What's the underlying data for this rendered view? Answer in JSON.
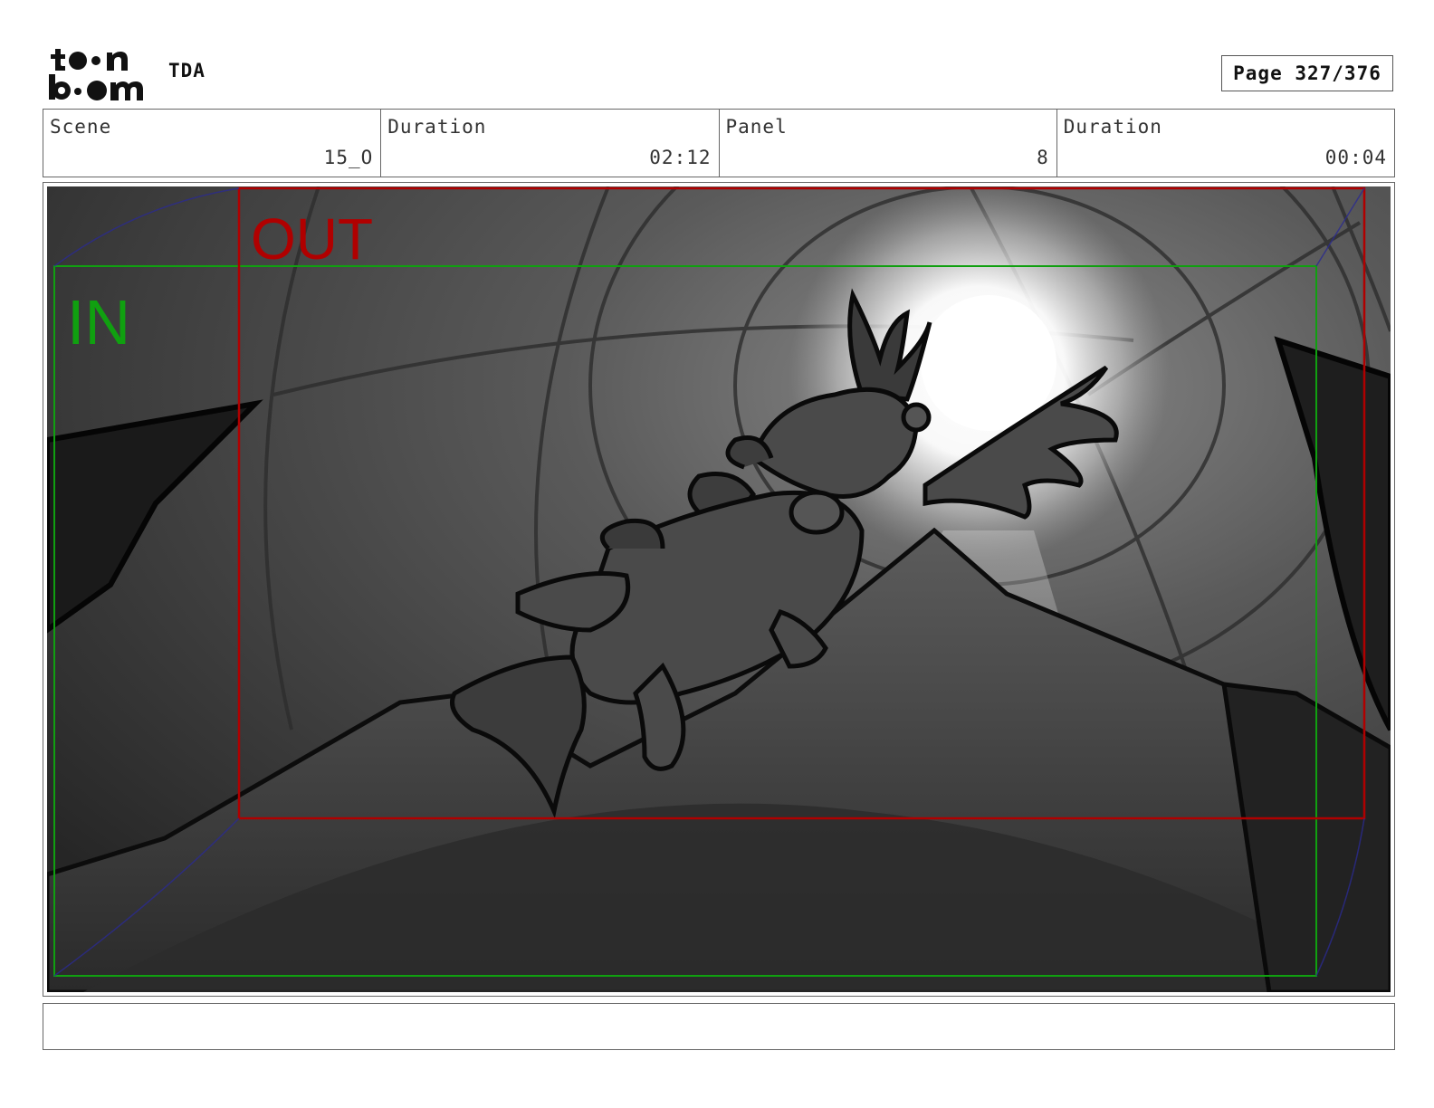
{
  "header": {
    "project": "TDA",
    "page": "Page 327/376"
  },
  "info": {
    "scene_label": "Scene",
    "scene_value": "15_O",
    "scene_duration_label": "Duration",
    "scene_duration_value": "02:12",
    "panel_label": "Panel",
    "panel_value": "8",
    "panel_duration_label": "Duration",
    "panel_duration_value": "00:04"
  },
  "frame_marks": {
    "in_label": "IN",
    "out_label": "OUT",
    "in_color": "#10a010",
    "out_color": "#b00000"
  },
  "notes": ""
}
